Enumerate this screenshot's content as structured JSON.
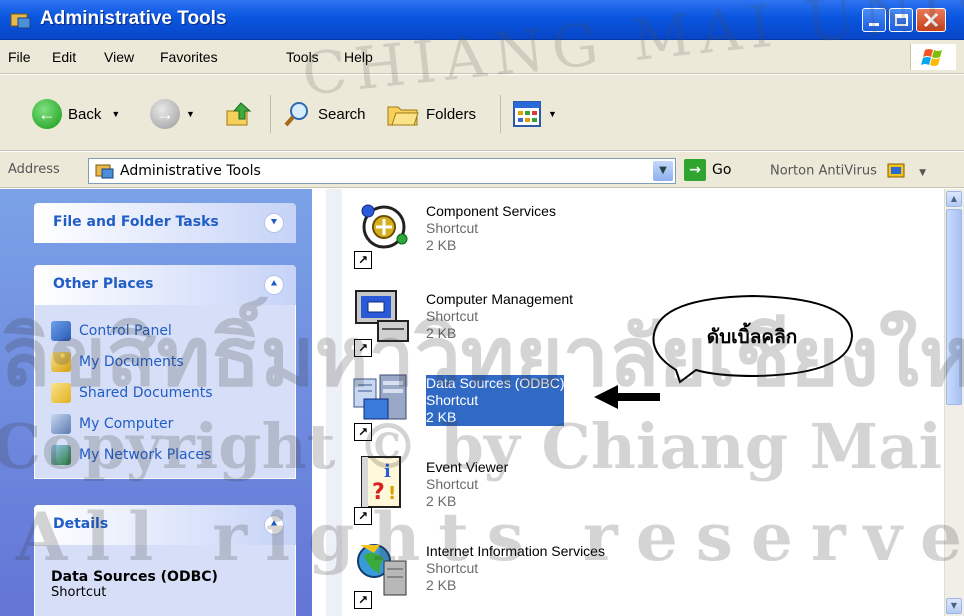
{
  "window": {
    "title": "Administrative Tools"
  },
  "menu": [
    "File",
    "Edit",
    "View",
    "Favorites",
    "Tools",
    "Help"
  ],
  "toolbar": {
    "back_label": "Back",
    "search_label": "Search",
    "folders_label": "Folders"
  },
  "address": {
    "label": "Address",
    "value": "Administrative Tools",
    "go_label": "Go",
    "norton_label": "Norton AntiVirus"
  },
  "left": {
    "file_tasks_title": "File and Folder Tasks",
    "other_places_title": "Other Places",
    "other_places": [
      {
        "label": "Control Panel",
        "icon": "control-panel-icon"
      },
      {
        "label": "My Documents",
        "icon": "my-documents-icon"
      },
      {
        "label": "Shared Documents",
        "icon": "folder-icon"
      },
      {
        "label": "My Computer",
        "icon": "my-computer-icon"
      },
      {
        "label": "My Network Places",
        "icon": "network-places-icon"
      }
    ],
    "details_title": "Details",
    "details_name": "Data Sources (ODBC)",
    "details_type": "Shortcut"
  },
  "files": [
    {
      "name": "Component Services",
      "type": "Shortcut",
      "size": "2 KB",
      "icon": "component-services-icon",
      "selected": false
    },
    {
      "name": "Computer Management",
      "type": "Shortcut",
      "size": "2 KB",
      "icon": "computer-management-icon",
      "selected": false
    },
    {
      "name": "Data Sources (ODBC)",
      "type": "Shortcut",
      "size": "2 KB",
      "icon": "data-sources-icon",
      "selected": true
    },
    {
      "name": "Event Viewer",
      "type": "Shortcut",
      "size": "2 KB",
      "icon": "event-viewer-icon",
      "selected": false
    },
    {
      "name": "Internet Information Services",
      "type": "Shortcut",
      "size": "2 KB",
      "icon": "iis-icon",
      "selected": false
    }
  ],
  "callout": {
    "text": "ดับเบิ้ลคลิก"
  },
  "watermark": {
    "line1": "ลิขสิทธิ์มหาวิทยาลัยเชียงใหม่",
    "line2": "Copyright © by Chiang Mai University",
    "line3": "All rights reserved",
    "arc": "CHIANG MAI UNIVERSITY"
  },
  "colors": {
    "titlebar": "#0a56e0",
    "chrome": "#ece9d8",
    "taskpane": "#6375d6",
    "link": "#215dc6",
    "selection": "#316ac5"
  }
}
